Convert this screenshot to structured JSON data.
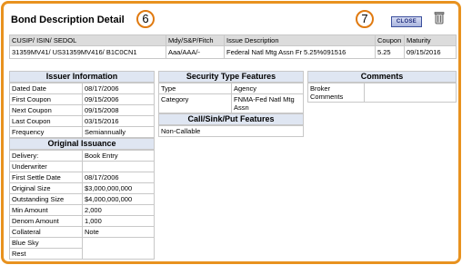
{
  "page": {
    "title": "Bond Description Detail"
  },
  "markers": {
    "left": "6",
    "right": "7"
  },
  "toolbar": {
    "close_label": "CLOSE"
  },
  "main_table": {
    "headers": [
      "CUSIP/ ISIN/ SEDOL",
      "Mdy/S&P/Fitch",
      "Issue Description",
      "Coupon",
      "Maturity"
    ],
    "row": [
      "31359MV41/ US31359MV416/ B1C0CN1",
      "Aaa/AAA/-",
      "Federal Natl Mtg Assn Fr 5.25%091516",
      "5.25",
      "09/15/2016"
    ]
  },
  "issuer_info": {
    "title": "Issuer Information",
    "rows": [
      [
        "Dated Date",
        "08/17/2006"
      ],
      [
        "First Coupon",
        "09/15/2006"
      ],
      [
        "Next Coupon",
        "09/15/2008"
      ],
      [
        "Last Coupon",
        "03/15/2016"
      ],
      [
        "Frequency",
        "Semiannually"
      ]
    ]
  },
  "original_issuance": {
    "title": "Original Issuance",
    "rows": [
      [
        "Delivery:",
        "Book Entry"
      ],
      [
        "Underwriter",
        ""
      ],
      [
        "First Settle Date",
        "08/17/2006"
      ],
      [
        "Original Size",
        "$3,000,000,000"
      ],
      [
        "Outstanding Size",
        "$4,000,000,000"
      ],
      [
        "Min Amount",
        "2,000"
      ],
      [
        "Denom Amount",
        "1,000"
      ],
      [
        "Collateral",
        "Note"
      ],
      [
        "Blue Sky",
        ""
      ],
      [
        "Rest",
        ""
      ]
    ]
  },
  "security_type": {
    "title": "Security Type Features",
    "rows": [
      [
        "Type",
        "Agency"
      ],
      [
        "Category",
        "FNMA-Fed Natl Mtg Assn"
      ]
    ]
  },
  "call_sink_put": {
    "title": "Call/Sink/Put Features",
    "value": "Non-Callable"
  },
  "comments": {
    "title": "Comments",
    "label": "Broker Comments",
    "value": ""
  }
}
